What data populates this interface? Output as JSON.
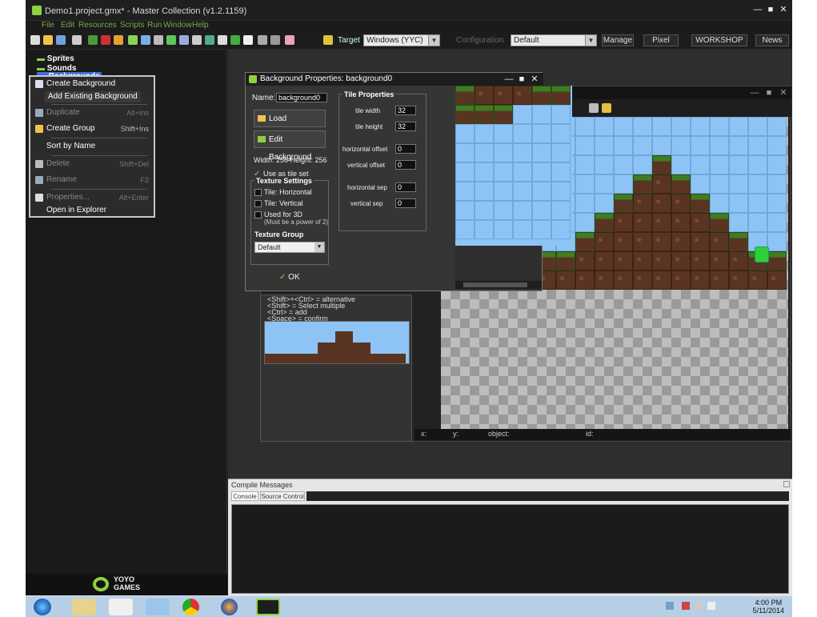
{
  "window": {
    "title": "Demo1.project.gmx* - Master Collection (v1.2.1159)",
    "menu": [
      "File",
      "Edit",
      "Resources",
      "Scripts",
      "Run",
      "Window",
      "Help"
    ]
  },
  "toolbar": {
    "target_label": "Target",
    "target_value": "Windows (YYC)",
    "config_label": "Configuration",
    "config_value": "Default",
    "buttons": [
      "Manage",
      "Pixel",
      "WORKSHOP",
      "News"
    ]
  },
  "tree": {
    "items": [
      "Sprites",
      "Sounds",
      "Backgrounds"
    ]
  },
  "context_menu": {
    "items": [
      {
        "label": "Create Background",
        "shortcut": ""
      },
      {
        "label": "Add Existing Background",
        "shortcut": ""
      },
      {
        "label": "Duplicate",
        "shortcut": "Alt+Ins"
      },
      {
        "label": "Create Group",
        "shortcut": "Shift+Ins"
      },
      {
        "label": "Sort by Name",
        "shortcut": ""
      },
      {
        "label": "Delete",
        "shortcut": "Shift+Del"
      },
      {
        "label": "Rename",
        "shortcut": "F2"
      },
      {
        "label": "Properties...",
        "shortcut": "Alt+Enter"
      },
      {
        "label": "Open in Explorer",
        "shortcut": ""
      }
    ]
  },
  "dialog": {
    "title": "Background Properties: background0",
    "name_label": "Name:",
    "name_value": "background0",
    "load_button": "Load Background",
    "edit_button": "Edit Background",
    "size_text": "Width: 256   Height: 256",
    "tileset_label": "Use as tile set",
    "texture_title": "Texture Settings",
    "tile_horizontal": "Tile: Horizontal",
    "tile_vertical": "Tile: Vertical",
    "used_3d": "Used for 3D",
    "used_3d_note": "(Must be a power of 2)",
    "texture_group_label": "Texture Group",
    "texture_group_value": "Default",
    "ok_button": "OK",
    "tile_props_title": "Tile Properties",
    "tile_width_label": "tile width",
    "tile_width": "32",
    "tile_height_label": "tile height",
    "tile_height": "32",
    "h_offset_label": "horizontal offset",
    "h_offset": "0",
    "v_offset_label": "vertical offset",
    "v_offset": "0",
    "h_sep_label": "horizontal sep",
    "h_sep": "0",
    "v_sep_label": "vertical sep",
    "v_sep": "0"
  },
  "room": {
    "hints": [
      "<Shift>+<Ctrl> = alternative",
      "<Shift> = Select multiple",
      "<Ctrl> = add",
      "<Space> = confirm"
    ],
    "bottom_x": "x:",
    "bottom_y": "y:",
    "bottom_object": "object:",
    "bottom_id": "id:"
  },
  "console": {
    "title": "Compile Messages",
    "tabs": [
      "Console",
      "Source Control"
    ]
  },
  "yoyo": {
    "line1": "YOYO",
    "line2": "GAMES"
  },
  "clock": {
    "time": "4:00 PM",
    "date": "5/11/2014"
  },
  "colors": {
    "sky": "#8ec4f5",
    "dirt": "#5a3422",
    "grass": "#3f7d23",
    "accent": "#8fd13f"
  }
}
